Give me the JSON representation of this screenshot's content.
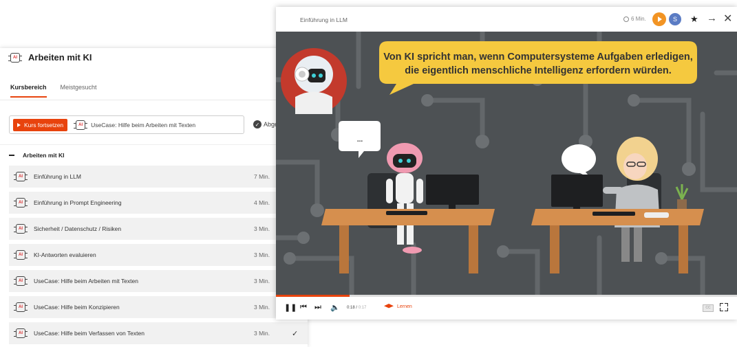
{
  "course_panel": {
    "title": "Arbeiten mit KI",
    "tabs": [
      {
        "label": "Kursbereich",
        "active": true
      },
      {
        "label": "Meistgesucht",
        "active": false
      }
    ],
    "continue_button": "Kurs fortsetzen",
    "continue_lesson": "UseCase: Hilfe beim Arbeiten mit Texten",
    "status_label": "Abge",
    "section_title": "Arbeiten mit KI",
    "lessons": [
      {
        "title": "Einführung in LLM",
        "duration": "7 Min.",
        "done": false
      },
      {
        "title": "Einführung in Prompt Engineering",
        "duration": "4 Min.",
        "done": false
      },
      {
        "title": "Sicherheit / Datenschutz / Risiken",
        "duration": "3 Min.",
        "done": false
      },
      {
        "title": "KI-Antworten evaluieren",
        "duration": "3 Min.",
        "done": false
      },
      {
        "title": "UseCase: Hilfe beim Arbeiten mit Texten",
        "duration": "3 Min.",
        "done": false
      },
      {
        "title": "UseCase: Hilfe beim Konzipieren",
        "duration": "3 Min.",
        "done": false
      },
      {
        "title": "UseCase: Hilfe beim Verfassen von Texten",
        "duration": "3 Min.",
        "done": true
      }
    ]
  },
  "player": {
    "title": "Einführung in LLM",
    "duration": "6 Min.",
    "blue_badge": "S",
    "speech_line1": "Von KI spricht man, wenn Computersysteme Aufgaben erledigen,",
    "speech_line2": "die eigentlich menschliche Intelligenz erfordern würden.",
    "small_bubble": "...",
    "time_current": "0:18",
    "time_total": "0:17",
    "progress_fraction": 0.16,
    "learn_label": "Lernen",
    "cc_label": "CC"
  },
  "colors": {
    "accent": "#e8430d",
    "video_bg": "#4d5154",
    "speech_yellow": "#f5c93f",
    "desk": "#d68f4e"
  },
  "icons": [
    "ai-chip-icon",
    "play-icon",
    "check-circle-icon",
    "clock-icon",
    "star-icon",
    "arrow-right-icon",
    "close-icon",
    "pause-icon",
    "skip-back-icon",
    "skip-forward-icon",
    "volume-icon",
    "graduation-cap-icon",
    "captions-icon",
    "fullscreen-icon",
    "checkmark-icon"
  ]
}
